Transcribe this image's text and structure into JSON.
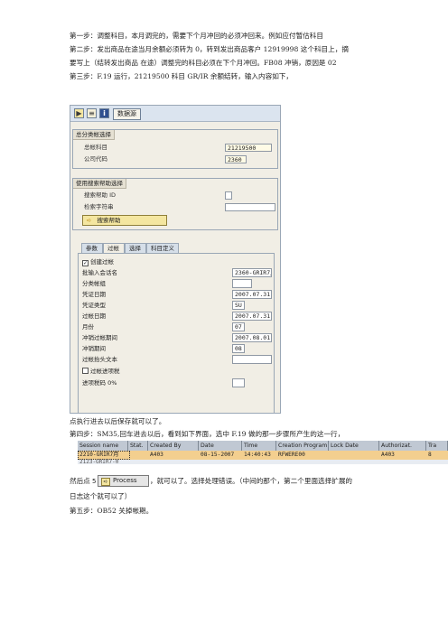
{
  "doc": {
    "line1": "第一步：调整科目，本月调完的，需要下个月冲回的必须冲回来。例如应付暂估科目",
    "line2": "第二步：发出商品在途当月余额必须转为 0，转到发出商品客户 12919998 这个科目上，摘",
    "line3": "要写上（结转发出商品 在途）调整完的科目必须在下个月冲回。FB08 冲销，原因是 02",
    "line4": "第三步：F.19 运行，21219500 科目 GR/IR 余额结转，输入内容如下，",
    "line5": "点执行进去以后保存就可以了。",
    "line6": "第四步：SM35,回车进去以后，看到如下界面，选中 F.19 做的那一步骤所产生的这一行，",
    "line7_before": "然后点",
    "line7_after": "，就可以了。选择处理错误。（中间的那个，第二个里面选择扩展的",
    "line8": "日志这个就可以了）",
    "line9": "第五步：OB52 关掉帐期。"
  },
  "sap": {
    "toolbar": {
      "exec_icon": "execute-icon",
      "variant_icon": "variant-icon",
      "info_icon": "info-icon",
      "data_source": "数据源"
    },
    "gl_group": {
      "title": "总分类帐选择",
      "account_label": "总帐科目",
      "account_value": "21219500",
      "company_label": "公司代码",
      "company_value": "2360"
    },
    "search_group": {
      "title": "使用搜索帮助选择",
      "help_id_label": "搜索帮助 ID",
      "help_id_value": "",
      "search_string_label": "检索字符串",
      "search_string_value": "",
      "search_help_button": "搜索帮助"
    },
    "tabs": [
      "参数",
      "过帐",
      "选择",
      "科目定义"
    ],
    "posting": {
      "create_posting_label": "创建过帐",
      "create_posting_checked": true,
      "rows": [
        {
          "label": "批输入会话名",
          "value": "2360-GRIR7月"
        },
        {
          "label": "分类帐组",
          "value": ""
        },
        {
          "label": "凭证日期",
          "value": "2007.07.31"
        },
        {
          "label": "凭证类型",
          "value": "SU"
        },
        {
          "label": "过帐日期",
          "value": "2007.07.31"
        },
        {
          "label": "月份",
          "value": "07"
        },
        {
          "label": "冲销过帐期间",
          "value": "2007.08.01"
        },
        {
          "label": "冲销期间",
          "value": "08"
        },
        {
          "label": "过帐抬头文本",
          "value": ""
        }
      ],
      "post_transfer_label": "过帐进项税",
      "post_transfer_checked": false,
      "tax_label": "进项税码 0%",
      "tax_value": ""
    }
  },
  "sm35": {
    "headers": [
      "Session name",
      "Stat.",
      "Created By",
      "Date",
      "Time",
      "Creation Program",
      "Lock Date",
      "Authorizat.",
      "Tra"
    ],
    "row": [
      "2210-GRIR7月",
      "",
      "A403",
      "08-15-2007",
      "14:40:43",
      "RFWERE00",
      "",
      "A403",
      "8"
    ],
    "partial_row": "2123-GRIR7-0"
  },
  "process_button": {
    "label": "Process",
    "prefix": "5"
  }
}
